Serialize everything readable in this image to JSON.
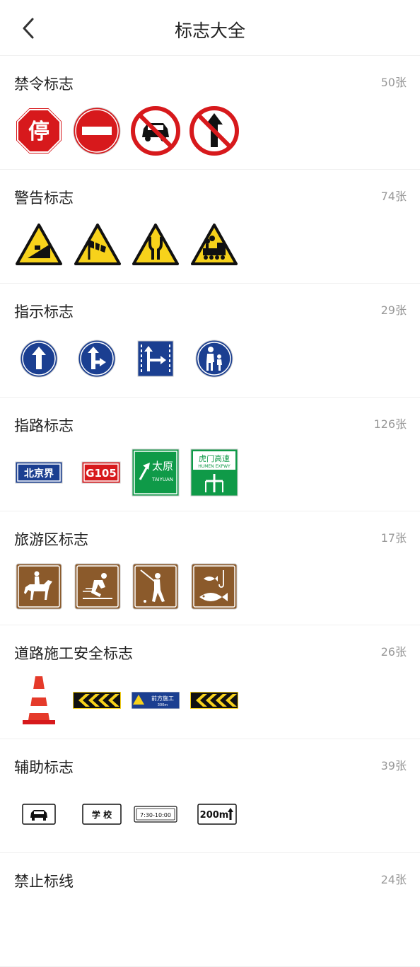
{
  "header": {
    "title": "标志大全"
  },
  "sections": [
    {
      "title": "禁令标志",
      "count": "50张"
    },
    {
      "title": "警告标志",
      "count": "74张"
    },
    {
      "title": "指示标志",
      "count": "29张"
    },
    {
      "title": "指路标志",
      "count": "126张"
    },
    {
      "title": "旅游区标志",
      "count": "17张"
    },
    {
      "title": "道路施工安全标志",
      "count": "26张"
    },
    {
      "title": "辅助标志",
      "count": "39张"
    },
    {
      "title": "禁止标线",
      "count": "24张"
    }
  ],
  "sign_text": {
    "stop": "停",
    "beijing": "北京界",
    "g105": "G105",
    "taiyuan_cn": "太原",
    "taiyuan_en": "TAIYUAN",
    "humen_cn": "虎门高速",
    "humen_en": "HUMEN EXPWY",
    "work_ahead": "前方施工",
    "work_dist": "300m",
    "school": "学 校",
    "time": "7:30-10:00",
    "dist200": "200m"
  },
  "colors": {
    "ban_red": "#d7191c",
    "warn_yellow": "#f7d21b",
    "info_blue": "#1b3f91",
    "guide_green": "#0f9a48",
    "tour_brown": "#8b5a2b"
  }
}
